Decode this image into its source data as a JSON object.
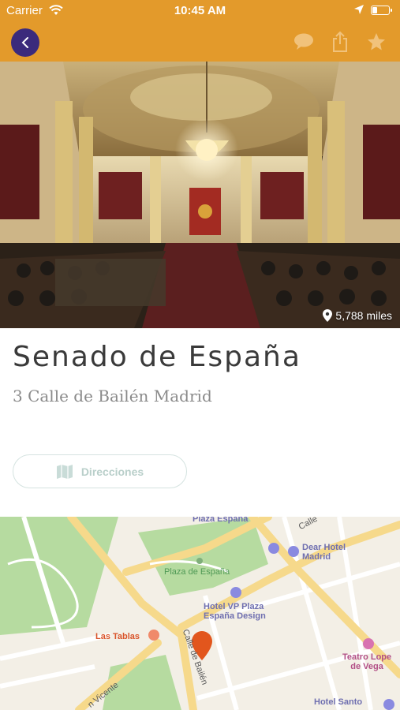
{
  "status_bar": {
    "carrier": "Carrier",
    "time": "10:45 AM"
  },
  "nav": {
    "back_icon": "chevron-left-icon",
    "actions": [
      "comment-icon",
      "share-icon",
      "star-icon"
    ],
    "accent_color": "#e39a2b",
    "back_button_color": "#3b2a7c"
  },
  "hero": {
    "distance": "5,788 miles"
  },
  "place": {
    "title": "Senado de España",
    "address": "3 Calle de Bailén Madrid"
  },
  "directions": {
    "label": "Direcciones"
  },
  "map": {
    "labels": {
      "plaza_espana_top": "Plaza España",
      "calle": "Calle",
      "dear_hotel": "Dear Hotel\nMadrid",
      "plaza_de_espana": "Plaza de España",
      "hotel_vp": "Hotel VP Plaza\nEspaña Design",
      "las_tablas": "Las Tablas",
      "calle_bailen": "Calle de Bailén",
      "teatro": "Teatro Lope\nde Vega",
      "san_vicente": "n Vicente",
      "hotel_santo": "Hotel Santo"
    }
  }
}
